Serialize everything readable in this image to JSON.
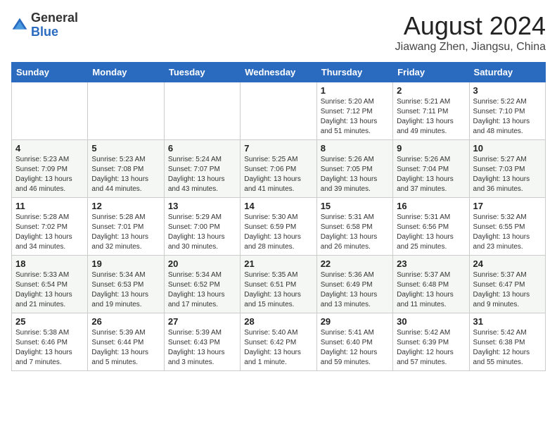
{
  "header": {
    "logo_general": "General",
    "logo_blue": "Blue",
    "title": "August 2024",
    "subtitle": "Jiawang Zhen, Jiangsu, China"
  },
  "weekdays": [
    "Sunday",
    "Monday",
    "Tuesday",
    "Wednesday",
    "Thursday",
    "Friday",
    "Saturday"
  ],
  "weeks": [
    [
      {
        "day": "",
        "info": ""
      },
      {
        "day": "",
        "info": ""
      },
      {
        "day": "",
        "info": ""
      },
      {
        "day": "",
        "info": ""
      },
      {
        "day": "1",
        "info": "Sunrise: 5:20 AM\nSunset: 7:12 PM\nDaylight: 13 hours\nand 51 minutes."
      },
      {
        "day": "2",
        "info": "Sunrise: 5:21 AM\nSunset: 7:11 PM\nDaylight: 13 hours\nand 49 minutes."
      },
      {
        "day": "3",
        "info": "Sunrise: 5:22 AM\nSunset: 7:10 PM\nDaylight: 13 hours\nand 48 minutes."
      }
    ],
    [
      {
        "day": "4",
        "info": "Sunrise: 5:23 AM\nSunset: 7:09 PM\nDaylight: 13 hours\nand 46 minutes."
      },
      {
        "day": "5",
        "info": "Sunrise: 5:23 AM\nSunset: 7:08 PM\nDaylight: 13 hours\nand 44 minutes."
      },
      {
        "day": "6",
        "info": "Sunrise: 5:24 AM\nSunset: 7:07 PM\nDaylight: 13 hours\nand 43 minutes."
      },
      {
        "day": "7",
        "info": "Sunrise: 5:25 AM\nSunset: 7:06 PM\nDaylight: 13 hours\nand 41 minutes."
      },
      {
        "day": "8",
        "info": "Sunrise: 5:26 AM\nSunset: 7:05 PM\nDaylight: 13 hours\nand 39 minutes."
      },
      {
        "day": "9",
        "info": "Sunrise: 5:26 AM\nSunset: 7:04 PM\nDaylight: 13 hours\nand 37 minutes."
      },
      {
        "day": "10",
        "info": "Sunrise: 5:27 AM\nSunset: 7:03 PM\nDaylight: 13 hours\nand 36 minutes."
      }
    ],
    [
      {
        "day": "11",
        "info": "Sunrise: 5:28 AM\nSunset: 7:02 PM\nDaylight: 13 hours\nand 34 minutes."
      },
      {
        "day": "12",
        "info": "Sunrise: 5:28 AM\nSunset: 7:01 PM\nDaylight: 13 hours\nand 32 minutes."
      },
      {
        "day": "13",
        "info": "Sunrise: 5:29 AM\nSunset: 7:00 PM\nDaylight: 13 hours\nand 30 minutes."
      },
      {
        "day": "14",
        "info": "Sunrise: 5:30 AM\nSunset: 6:59 PM\nDaylight: 13 hours\nand 28 minutes."
      },
      {
        "day": "15",
        "info": "Sunrise: 5:31 AM\nSunset: 6:58 PM\nDaylight: 13 hours\nand 26 minutes."
      },
      {
        "day": "16",
        "info": "Sunrise: 5:31 AM\nSunset: 6:56 PM\nDaylight: 13 hours\nand 25 minutes."
      },
      {
        "day": "17",
        "info": "Sunrise: 5:32 AM\nSunset: 6:55 PM\nDaylight: 13 hours\nand 23 minutes."
      }
    ],
    [
      {
        "day": "18",
        "info": "Sunrise: 5:33 AM\nSunset: 6:54 PM\nDaylight: 13 hours\nand 21 minutes."
      },
      {
        "day": "19",
        "info": "Sunrise: 5:34 AM\nSunset: 6:53 PM\nDaylight: 13 hours\nand 19 minutes."
      },
      {
        "day": "20",
        "info": "Sunrise: 5:34 AM\nSunset: 6:52 PM\nDaylight: 13 hours\nand 17 minutes."
      },
      {
        "day": "21",
        "info": "Sunrise: 5:35 AM\nSunset: 6:51 PM\nDaylight: 13 hours\nand 15 minutes."
      },
      {
        "day": "22",
        "info": "Sunrise: 5:36 AM\nSunset: 6:49 PM\nDaylight: 13 hours\nand 13 minutes."
      },
      {
        "day": "23",
        "info": "Sunrise: 5:37 AM\nSunset: 6:48 PM\nDaylight: 13 hours\nand 11 minutes."
      },
      {
        "day": "24",
        "info": "Sunrise: 5:37 AM\nSunset: 6:47 PM\nDaylight: 13 hours\nand 9 minutes."
      }
    ],
    [
      {
        "day": "25",
        "info": "Sunrise: 5:38 AM\nSunset: 6:46 PM\nDaylight: 13 hours\nand 7 minutes."
      },
      {
        "day": "26",
        "info": "Sunrise: 5:39 AM\nSunset: 6:44 PM\nDaylight: 13 hours\nand 5 minutes."
      },
      {
        "day": "27",
        "info": "Sunrise: 5:39 AM\nSunset: 6:43 PM\nDaylight: 13 hours\nand 3 minutes."
      },
      {
        "day": "28",
        "info": "Sunrise: 5:40 AM\nSunset: 6:42 PM\nDaylight: 13 hours\nand 1 minute."
      },
      {
        "day": "29",
        "info": "Sunrise: 5:41 AM\nSunset: 6:40 PM\nDaylight: 12 hours\nand 59 minutes."
      },
      {
        "day": "30",
        "info": "Sunrise: 5:42 AM\nSunset: 6:39 PM\nDaylight: 12 hours\nand 57 minutes."
      },
      {
        "day": "31",
        "info": "Sunrise: 5:42 AM\nSunset: 6:38 PM\nDaylight: 12 hours\nand 55 minutes."
      }
    ]
  ]
}
